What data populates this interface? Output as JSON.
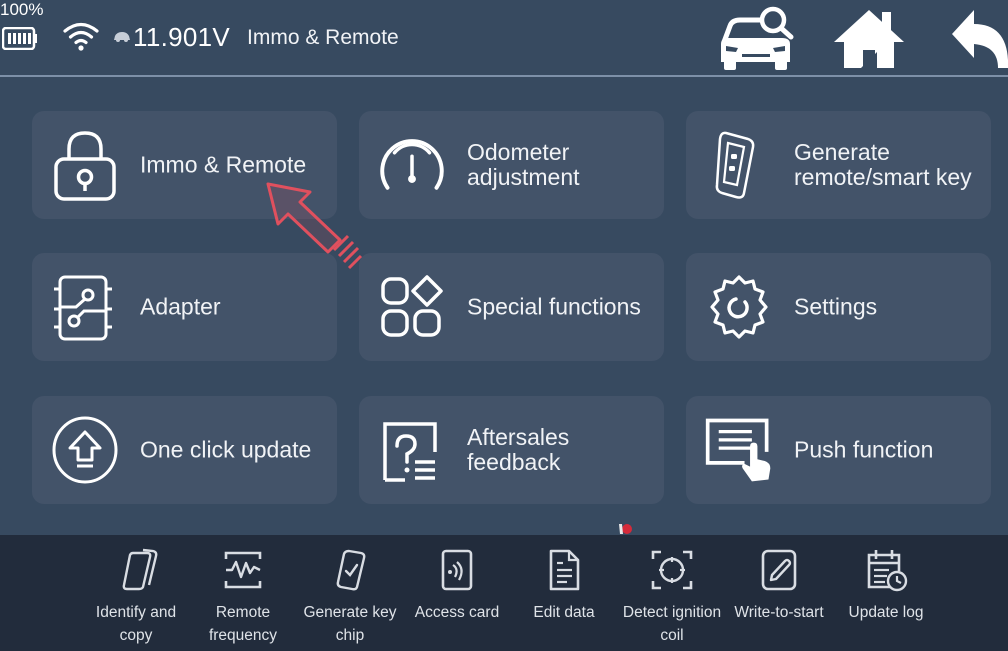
{
  "status_bar": {
    "battery_percent": "100%",
    "voltage": "11.901V",
    "title": "Immo & Remote"
  },
  "header_buttons": {
    "car_search": "vehicle-search",
    "home": "home",
    "back": "back"
  },
  "tiles": [
    {
      "label": "Immo & Remote",
      "icon": "padlock-icon"
    },
    {
      "label": "Odometer adjustment",
      "icon": "gauge-icon"
    },
    {
      "label": "Generate remote/smart key",
      "icon": "key-fob-icon"
    },
    {
      "label": "Adapter",
      "icon": "circuit-chip-icon"
    },
    {
      "label": "Special functions",
      "icon": "shapes-grid-icon"
    },
    {
      "label": "Settings",
      "icon": "gear-icon"
    },
    {
      "label": "One click update",
      "icon": "upload-arrow-icon"
    },
    {
      "label": "Aftersales feedback",
      "icon": "question-list-icon"
    },
    {
      "label": "Push function",
      "icon": "touch-screen-icon"
    }
  ],
  "bottom_bar": [
    {
      "label": "Identify and copy",
      "icon": "cards-copy-icon"
    },
    {
      "label": "Remote frequency",
      "icon": "waveform-icon"
    },
    {
      "label": "Generate key chip",
      "icon": "chip-check-icon"
    },
    {
      "label": "Access card",
      "icon": "nfc-card-icon"
    },
    {
      "label": "Edit data",
      "icon": "document-icon"
    },
    {
      "label": "Detect ignition coil",
      "icon": "target-scan-icon"
    },
    {
      "label": "Write-to-start",
      "icon": "pencil-square-icon"
    },
    {
      "label": "Update log",
      "icon": "calendar-clock-icon"
    }
  ],
  "colors": {
    "background": "#374a60",
    "tile": "#435369",
    "bottom_bar": "#222c3c",
    "annotation_arrow": "#e0505e"
  }
}
